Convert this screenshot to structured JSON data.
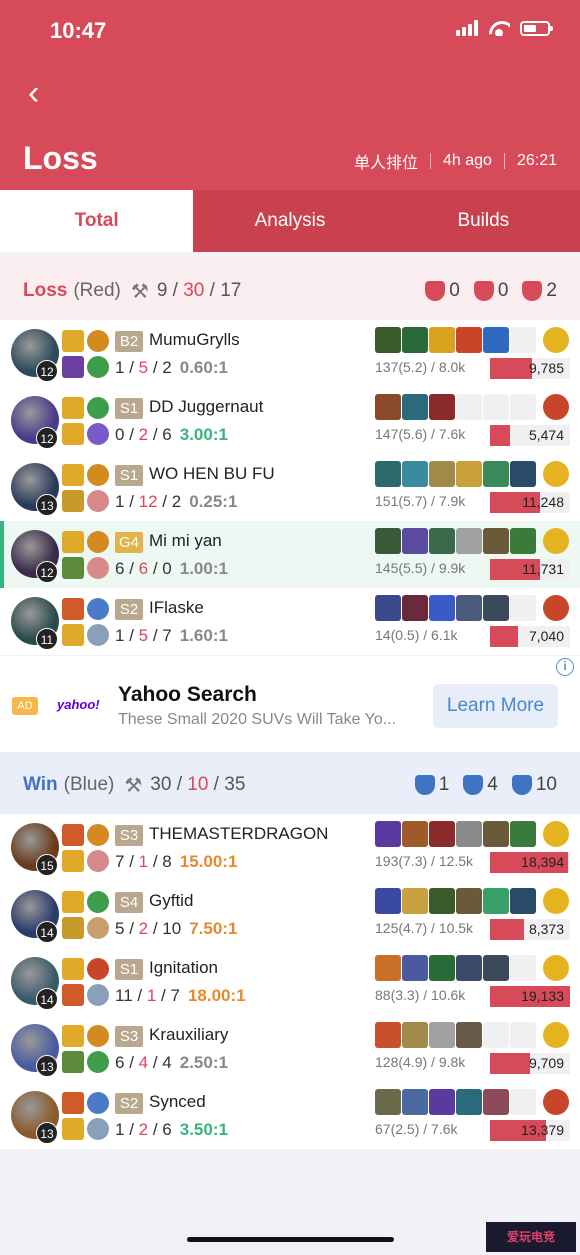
{
  "status_bar": {
    "time": "10:47"
  },
  "header": {
    "back_icon": "chevron-left-icon",
    "title": "Loss",
    "queue": "单人排位",
    "ago": "4h ago",
    "duration": "26:21"
  },
  "tabs": [
    {
      "label": "Total",
      "active": true
    },
    {
      "label": "Analysis",
      "active": false
    },
    {
      "label": "Builds",
      "active": false
    }
  ],
  "red_team": {
    "result": "Loss",
    "side": "(Red)",
    "kills": "9",
    "deaths": "30",
    "assists": "17",
    "towers": "0",
    "dragons": "0",
    "barons": "2",
    "players": [
      {
        "level": "12",
        "tier": "B2",
        "name": "MumuGrylls",
        "k": "1",
        "d": "5",
        "a": "2",
        "ratio": "0.60:1",
        "ratio_color": "gray",
        "cs": "137(5.2) / 8.0k",
        "damage": "9,785",
        "damage_frac": 0.53,
        "empty_items": 1,
        "colors": {
          "avatar": "#2d4a5a",
          "sp1": "#e0a92a",
          "sp2": "#6a3fa0",
          "rn1": "#d48a1e",
          "rn2": "#3e9d4a",
          "trinket": "#e6b320",
          "items": [
            "#3a5a2a",
            "#2a6a3a",
            "#d9a320",
            "#c8452a",
            "#2d6ac0"
          ]
        }
      },
      {
        "level": "12",
        "tier": "S1",
        "name": "DD Juggernaut",
        "k": "0",
        "d": "2",
        "a": "6",
        "ratio": "3.00:1",
        "ratio_color": "green",
        "cs": "147(5.6) / 7.6k",
        "damage": "5,474",
        "damage_frac": 0.25,
        "empty_items": 3,
        "colors": {
          "avatar": "#4a3a8a",
          "sp1": "#e0a92a",
          "sp2": "#e0a92a",
          "rn1": "#3e9d4a",
          "rn2": "#7a5ac8",
          "trinket": "#c8452a",
          "items": [
            "#8a4a2a",
            "#2a6a7a",
            "#8a2a2a"
          ]
        }
      },
      {
        "level": "13",
        "tier": "S1",
        "name": "WO HEN BU FU",
        "k": "1",
        "d": "12",
        "a": "2",
        "ratio": "0.25:1",
        "ratio_color": "gray",
        "cs": "151(5.7) / 7.9k",
        "damage": "11,248",
        "damage_frac": 0.62,
        "empty_items": 0,
        "colors": {
          "avatar": "#2a3a5a",
          "sp1": "#e0a92a",
          "sp2": "#c89a2a",
          "rn1": "#d48a1e",
          "rn2": "#d88a8a",
          "trinket": "#e6b320",
          "items": [
            "#2a6a6a",
            "#3a8aa0",
            "#a08a4a",
            "#c8a03a",
            "#3a8a5a",
            "#2a4a6a"
          ]
        }
      },
      {
        "level": "12",
        "tier": "G4",
        "tier_gold": true,
        "name": "Mi mi yan",
        "k": "6",
        "d": "6",
        "a": "0",
        "ratio": "1.00:1",
        "ratio_color": "gray",
        "cs": "145(5.5) / 9.9k",
        "damage": "11,731",
        "damage_frac": 0.62,
        "empty_items": 0,
        "me": true,
        "colors": {
          "avatar": "#3a2a4a",
          "sp1": "#e0a92a",
          "sp2": "#5a8a3a",
          "rn1": "#d48a1e",
          "rn2": "#d88a8a",
          "trinket": "#e6b320",
          "items": [
            "#3a5a3a",
            "#5a4aa0",
            "#3a6a4a",
            "#a0a0a0",
            "#6a5a3a",
            "#3a7a3a"
          ]
        }
      },
      {
        "level": "11",
        "tier": "S2",
        "name": "IFlaske",
        "k": "1",
        "d": "5",
        "a": "7",
        "ratio": "1.60:1",
        "ratio_color": "gray",
        "cs": "14(0.5) / 6.1k",
        "damage": "7,040",
        "damage_frac": 0.35,
        "empty_items": 1,
        "colors": {
          "avatar": "#2a4a4a",
          "sp1": "#d05a2a",
          "sp2": "#e0a92a",
          "rn1": "#4a7ac8",
          "rn2": "#8aa0b8",
          "trinket": "#c8452a",
          "items": [
            "#3a4a8a",
            "#6a2a3a",
            "#3a5ac8",
            "#4a5a7a",
            "#3a4a5a"
          ]
        }
      }
    ]
  },
  "ad": {
    "badge": "AD",
    "logo": "yahoo!",
    "title": "Yahoo Search",
    "text": "These Small 2020 SUVs Will Take Yo...",
    "button": "Learn More",
    "info_icon": "i"
  },
  "blue_team": {
    "result": "Win",
    "side": "(Blue)",
    "kills": "30",
    "deaths": "10",
    "assists": "35",
    "towers": "1",
    "dragons": "4",
    "barons": "10",
    "players": [
      {
        "level": "15",
        "tier": "S3",
        "name": "THEMASTERDRAGON",
        "k": "7",
        "d": "1",
        "a": "8",
        "ratio": "15.00:1",
        "ratio_color": "orange",
        "cs": "193(7.3) / 12.5k",
        "damage": "18,394",
        "damage_frac": 0.97,
        "empty_items": 0,
        "colors": {
          "avatar": "#6a3a1a",
          "sp1": "#d05a2a",
          "sp2": "#e0a92a",
          "rn1": "#d48a1e",
          "rn2": "#d88a8a",
          "trinket": "#e6b320",
          "items": [
            "#5a3aa0",
            "#a05a2a",
            "#8a2a2a",
            "#8a8a8a",
            "#6a5a3a",
            "#3a7a3a"
          ]
        }
      },
      {
        "level": "14",
        "tier": "S4",
        "name": "Gyftid",
        "k": "5",
        "d": "2",
        "a": "10",
        "ratio": "7.50:1",
        "ratio_color": "orange",
        "cs": "125(4.7) / 10.5k",
        "damage": "8,373",
        "damage_frac": 0.42,
        "empty_items": 0,
        "colors": {
          "avatar": "#2a3a6a",
          "sp1": "#e0a92a",
          "sp2": "#c89a2a",
          "rn1": "#3e9d4a",
          "rn2": "#c8a070",
          "trinket": "#e6b320",
          "items": [
            "#3a4aa0",
            "#c8a040",
            "#3a5a2a",
            "#6a5a3a",
            "#3aa06a",
            "#2a4a6a"
          ]
        }
      },
      {
        "level": "14",
        "tier": "S1",
        "name": "Ignitation",
        "k": "11",
        "d": "1",
        "a": "7",
        "ratio": "18.00:1",
        "ratio_color": "orange",
        "cs": "88(3.3) / 10.6k",
        "damage": "19,133",
        "damage_frac": 1.0,
        "empty_items": 1,
        "colors": {
          "avatar": "#3a5a6a",
          "sp1": "#e0a92a",
          "sp2": "#d05a2a",
          "rn1": "#c8452a",
          "rn2": "#8aa0b8",
          "trinket": "#e6b320",
          "items": [
            "#c8702a",
            "#4a5aa0",
            "#2a6a3a",
            "#3a4a6a",
            "#3a4a5a"
          ]
        }
      },
      {
        "level": "13",
        "tier": "S3",
        "name": "Krauxiliary",
        "k": "6",
        "d": "4",
        "a": "4",
        "ratio": "2.50:1",
        "ratio_color": "gray",
        "cs": "128(4.9) / 9.8k",
        "damage": "9,709",
        "damage_frac": 0.5,
        "empty_items": 2,
        "colors": {
          "avatar": "#4a5aa0",
          "sp1": "#e0a92a",
          "sp2": "#5a8a3a",
          "rn1": "#d48a1e",
          "rn2": "#3e9d4a",
          "trinket": "#e6b320",
          "items": [
            "#c8502a",
            "#a08a4a",
            "#a0a0a0",
            "#6a5a4a"
          ]
        }
      },
      {
        "level": "13",
        "tier": "S2",
        "name": "Synced",
        "k": "1",
        "d": "2",
        "a": "6",
        "ratio": "3.50:1",
        "ratio_color": "green",
        "cs": "67(2.5) / 7.6k",
        "damage": "13,379",
        "damage_frac": 0.7,
        "empty_items": 1,
        "colors": {
          "avatar": "#8a5a2a",
          "sp1": "#d05a2a",
          "sp2": "#e0a92a",
          "rn1": "#4a7ac8",
          "rn2": "#8aa0b8",
          "trinket": "#c8452a",
          "items": [
            "#6a6a4a",
            "#4a6aa0",
            "#5a3aa0",
            "#2a6a7a",
            "#8a4a5a"
          ]
        }
      }
    ]
  },
  "watermark": "爱玩电竞"
}
